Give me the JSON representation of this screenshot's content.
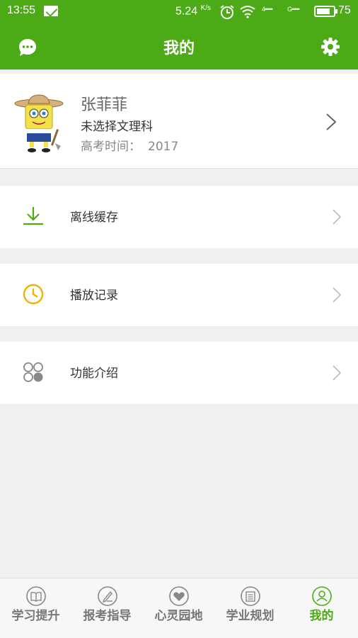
{
  "status_bar": {
    "time": "13:55",
    "speed": "5.24",
    "speed_unit": "K/s",
    "signal_1": "4•••••",
    "signal_2": "G•••••",
    "battery_level": "75",
    "icons": [
      "mail-icon",
      "alarm-icon",
      "wifi-icon",
      "signal-icon",
      "battery-icon"
    ]
  },
  "header": {
    "title": "我的",
    "left_icon": "chat-icon",
    "right_icon": "gear-icon"
  },
  "profile": {
    "name": "张菲菲",
    "subject": "未选择文理科",
    "exam_label": "高考时间：",
    "exam_year": "2017",
    "avatar": "spongebob-avatar"
  },
  "menu": [
    {
      "label": "离线缓存",
      "icon": "download-icon"
    },
    {
      "label": "播放记录",
      "icon": "clock-icon"
    },
    {
      "label": "功能介绍",
      "icon": "apps-icon"
    }
  ],
  "bottom_nav": [
    {
      "label": "学习提升",
      "icon": "book-icon",
      "active": false
    },
    {
      "label": "报考指导",
      "icon": "pen-icon",
      "active": false
    },
    {
      "label": "心灵园地",
      "icon": "heart-icon",
      "active": false
    },
    {
      "label": "学业规划",
      "icon": "list-icon",
      "active": false
    },
    {
      "label": "我的",
      "icon": "user-icon",
      "active": true
    }
  ],
  "colors": {
    "brand_green": "#4caa16",
    "download_green": "#4caa16",
    "clock_yellow": "#f0b400",
    "apps_gray": "#888888"
  }
}
